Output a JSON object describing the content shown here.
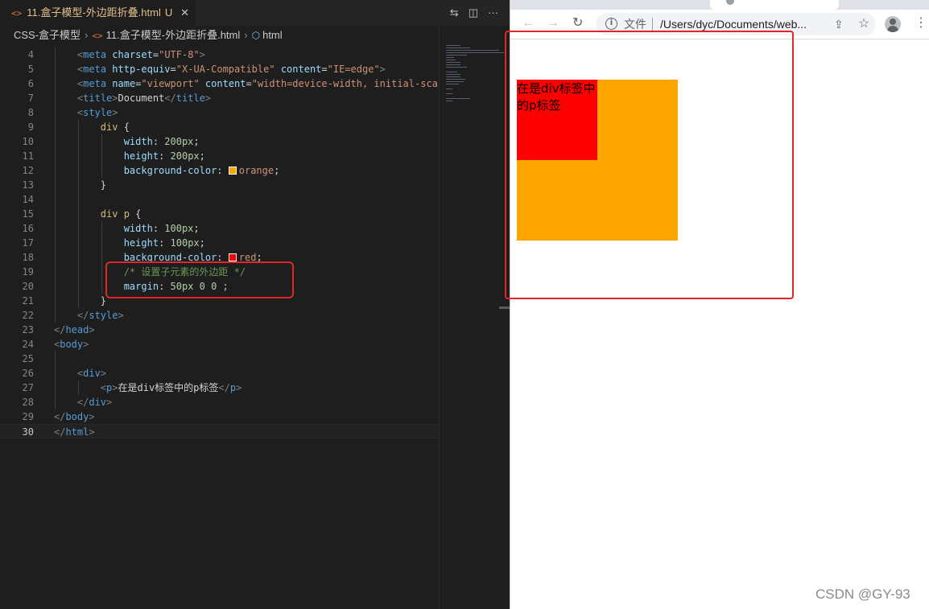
{
  "editor": {
    "tab": {
      "file_icon": "<>",
      "title": "11.盒子模型-外边距折叠.html",
      "modified_marker": "U",
      "close_glyph": "✕"
    },
    "actions": {
      "compare_icon": "⇆",
      "split_icon": "◫",
      "more_icon": "···"
    },
    "breadcrumb": {
      "folder": "CSS-盒子模型",
      "file_icon": "<>",
      "file": "11.盒子模型-外边距折叠.html",
      "element_icon": "⬡",
      "element": "html",
      "separator": "›"
    },
    "line_numbers": [
      "4",
      "5",
      "6",
      "7",
      "8",
      "9",
      "10",
      "11",
      "12",
      "13",
      "14",
      "15",
      "16",
      "17",
      "18",
      "19",
      "20",
      "21",
      "22",
      "23",
      "24",
      "25",
      "26",
      "27",
      "28",
      "29",
      "30"
    ],
    "code": {
      "l4": {
        "attr": "charset",
        "val": "\"UTF-8\""
      },
      "l5": {
        "attr1": "http-equiv",
        "val1": "\"X-UA-Compatible\"",
        "attr2": "content",
        "val2": "\"IE=edge\""
      },
      "l6": {
        "attr1": "name",
        "val1": "\"viewport\"",
        "attr2": "content",
        "val2": "\"width=device-width, initial-sca"
      },
      "l7": {
        "text": "Document"
      },
      "l9": {
        "selector": "div"
      },
      "l10": {
        "prop": "width",
        "value": "200px"
      },
      "l11": {
        "prop": "height",
        "value": "200px"
      },
      "l12": {
        "prop": "background-color",
        "value": "orange",
        "swatch": "#ffa500"
      },
      "l15": {
        "selector": "div p"
      },
      "l16": {
        "prop": "width",
        "value": "100px"
      },
      "l17": {
        "prop": "height",
        "value": "100px"
      },
      "l18": {
        "prop": "background-color",
        "value": "red",
        "swatch": "#ff0000"
      },
      "l19": {
        "comment": "/* 设置子元素的外边距 */"
      },
      "l20": {
        "prop": "margin",
        "value": "50px 0 0 ;"
      },
      "l27": {
        "text": "在是div标签中的p标签"
      }
    }
  },
  "browser": {
    "nav": {
      "back": "←",
      "forward": "→",
      "reload": "↻"
    },
    "omnibox": {
      "info_glyph": "i",
      "security_label": "文件",
      "url": "/Users/dyc/Documents/web..."
    },
    "share_glyph": "⇪",
    "star_glyph": "☆",
    "menu_glyph": "⋮",
    "page": {
      "div_color": "orange",
      "p_color": "red",
      "p_text": "在是div标签中的p标签"
    }
  },
  "watermark": "CSDN @GY-93"
}
